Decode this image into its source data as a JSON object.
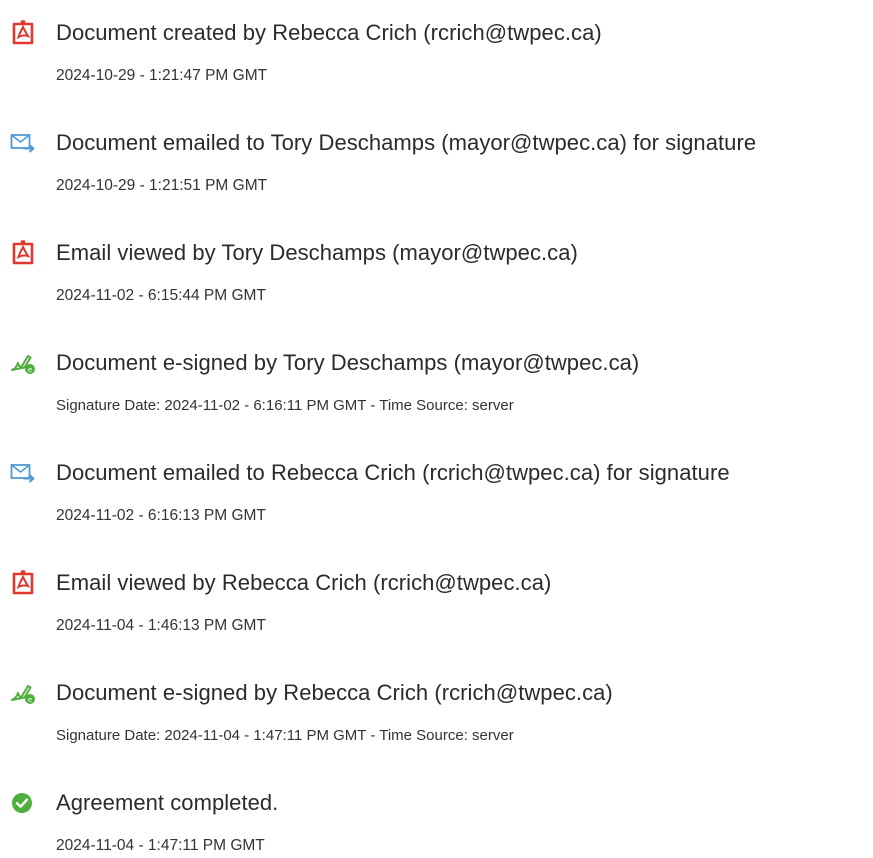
{
  "colors": {
    "pdf_icon": "#e0382e",
    "email_icon": "#4f9ad6",
    "esign_icon": "#4fae3d",
    "completed_icon": "#4fae3d",
    "text": "#2b2b2b"
  },
  "events": [
    {
      "icon": "pdf-document-icon",
      "title": "Document created by Rebecca Crich (rcrich@twpec.ca)",
      "timestamp": "2024-10-29 - 1:21:47 PM GMT"
    },
    {
      "icon": "email-sent-icon",
      "title": "Document emailed to Tory Deschamps (mayor@twpec.ca) for signature",
      "timestamp": "2024-10-29 - 1:21:51 PM GMT"
    },
    {
      "icon": "pdf-document-icon",
      "title": "Email viewed by Tory Deschamps (mayor@twpec.ca)",
      "timestamp": "2024-11-02 - 6:15:44 PM GMT"
    },
    {
      "icon": "e-sign-pen-icon",
      "title": "Document e-signed by Tory Deschamps (mayor@twpec.ca)",
      "timestamp": "Signature Date: 2024-11-02 - 6:16:11 PM GMT - Time Source: server"
    },
    {
      "icon": "email-sent-icon",
      "title": "Document emailed to Rebecca Crich (rcrich@twpec.ca) for signature",
      "timestamp": "2024-11-02 - 6:16:13 PM GMT"
    },
    {
      "icon": "pdf-document-icon",
      "title": "Email viewed by Rebecca Crich (rcrich@twpec.ca)",
      "timestamp": "2024-11-04 - 1:46:13 PM GMT"
    },
    {
      "icon": "e-sign-pen-icon",
      "title": "Document e-signed by Rebecca Crich (rcrich@twpec.ca)",
      "timestamp": "Signature Date: 2024-11-04 - 1:47:11 PM GMT - Time Source: server"
    },
    {
      "icon": "check-circle-icon",
      "title": "Agreement completed.",
      "timestamp": "2024-11-04 - 1:47:11 PM GMT"
    }
  ]
}
